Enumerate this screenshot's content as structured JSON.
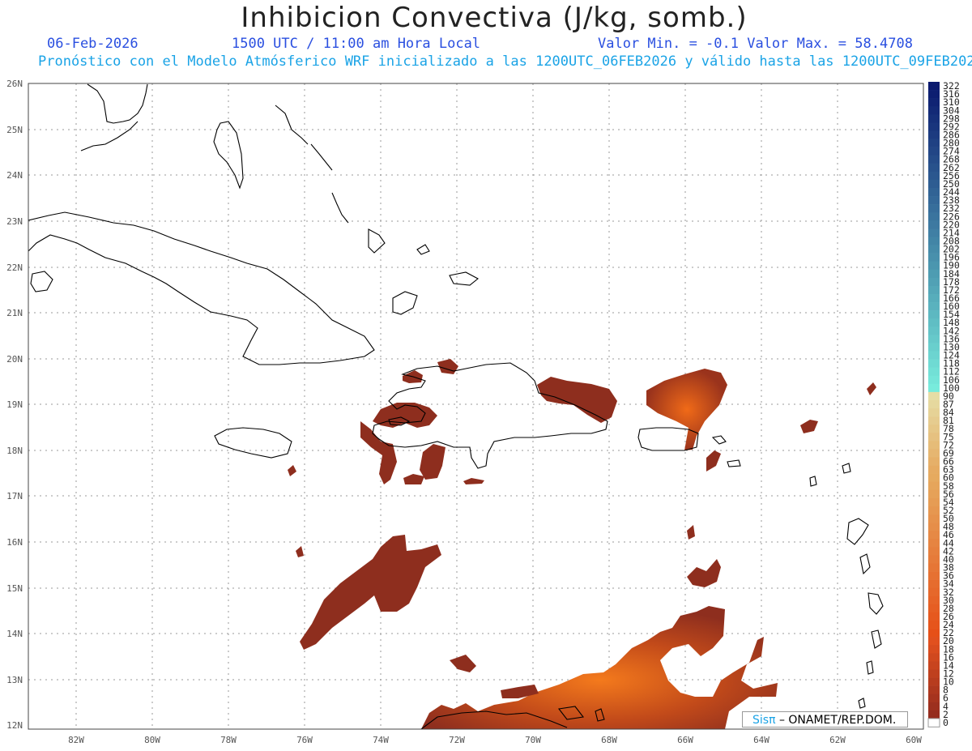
{
  "title": "Inhibicion Convectiva (J/kg, somb.)",
  "header": {
    "date": "06-Feb-2026",
    "time": "1500 UTC / 11:00 am Hora Local",
    "range": "Valor Min. = -0.1  Valor Max. = 58.4708",
    "forecast": "Pronóstico con el Modelo Atmósferico WRF inicializado a las 1200UTC_06FEB2026 y válido hasta las  1200UTC_09FEB2026"
  },
  "map": {
    "lat_labels": [
      "26N",
      "25N",
      "24N",
      "23N",
      "22N",
      "21N",
      "20N",
      "19N",
      "18N",
      "17N",
      "16N",
      "15N",
      "14N",
      "13N",
      "12N"
    ],
    "lon_labels": [
      "82W",
      "80W",
      "78W",
      "76W",
      "74W",
      "72W",
      "70W",
      "68W",
      "66W",
      "64W",
      "62W",
      "60W"
    ]
  },
  "colorbar": {
    "labels": [
      "322",
      "316",
      "310",
      "304",
      "298",
      "292",
      "286",
      "280",
      "274",
      "268",
      "262",
      "256",
      "250",
      "244",
      "238",
      "232",
      "226",
      "220",
      "214",
      "208",
      "202",
      "196",
      "190",
      "184",
      "178",
      "172",
      "166",
      "160",
      "154",
      "148",
      "142",
      "136",
      "130",
      "124",
      "118",
      "112",
      "106",
      "100",
      "90",
      "87",
      "84",
      "81",
      "78",
      "75",
      "72",
      "69",
      "66",
      "63",
      "60",
      "58",
      "56",
      "54",
      "52",
      "50",
      "48",
      "46",
      "44",
      "42",
      "40",
      "38",
      "36",
      "34",
      "32",
      "30",
      "28",
      "26",
      "24",
      "22",
      "20",
      "18",
      "16",
      "14",
      "12",
      "10",
      "8",
      "6",
      "4",
      "2",
      "0"
    ]
  },
  "credit": {
    "brand": "Sisπ",
    "text": "– ONAMET/REP.DOM."
  },
  "colors": {
    "fill_dark": "#8e2e1e",
    "fill_mid": "#b8441a",
    "fill_hot": "#f06a18",
    "coast": "#000000",
    "grid": "#888888"
  }
}
